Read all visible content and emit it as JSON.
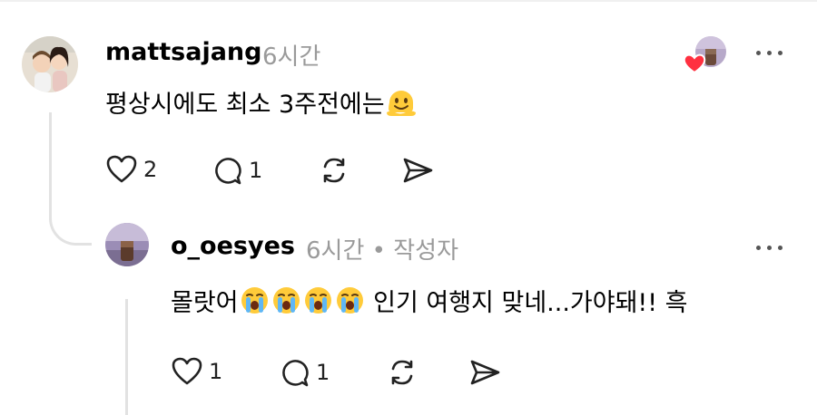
{
  "comment": {
    "username": "mattsajang",
    "time": "6시간",
    "text": "평상시에도 최소 3주전에는",
    "emoji": "melting-face",
    "likes": "2",
    "replies": "1"
  },
  "reply": {
    "username": "o_oesyes",
    "time": "6시간 • 작성자",
    "text_before": "몰랏어",
    "emoji": "loudly-crying-face",
    "emoji_count": 4,
    "text_after": " 인기 여행지 맞네...가야돼!! 흑",
    "likes": "1",
    "replies": "1"
  },
  "colors": {
    "heart_badge": "#ff3040",
    "muted_text": "#9a9a9a",
    "thread_line": "#e2e2e2"
  }
}
